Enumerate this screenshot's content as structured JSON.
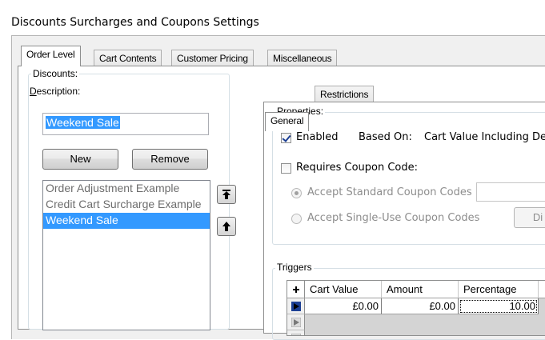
{
  "window": {
    "title": "Discounts Surcharges and Coupons Settings"
  },
  "main_tabs": [
    {
      "label": "Order Level",
      "active": true
    },
    {
      "label": "Cart Contents",
      "active": false
    },
    {
      "label": "Customer Pricing",
      "active": false
    },
    {
      "label": "Miscellaneous",
      "active": false
    }
  ],
  "discounts": {
    "group_label": "Discounts:",
    "description_label": "Description:",
    "description_value": "Weekend Sale",
    "new_button": "New",
    "remove_button": "Remove",
    "list_items": [
      {
        "label": "Order Adjustment Example",
        "selected": false
      },
      {
        "label": "Credit Cart Surcharge Example",
        "selected": false
      },
      {
        "label": "Weekend Sale",
        "selected": true
      }
    ],
    "move_top_icon": "move-to-top-icon",
    "move_up_icon": "move-up-icon"
  },
  "detail_tabs": [
    {
      "label": "General",
      "active": true
    },
    {
      "label": "Restrictions",
      "active": false
    }
  ],
  "properties": {
    "group_label": "Properties:",
    "enabled_label": "Enabled",
    "enabled_checked": true,
    "based_on_label": "Based On:",
    "based_on_value": "Cart Value Including De",
    "requires_coupon_label": "Requires Coupon Code:",
    "requires_coupon_checked": false,
    "accept_standard_label": "Accept Standard Coupon Codes",
    "accept_standard_checked": true,
    "accept_single_use_label": "Accept Single-Use Coupon Codes",
    "accept_single_use_checked": false,
    "single_use_button": "Di"
  },
  "triggers": {
    "group_label": "Triggers",
    "add_icon": "add-icon",
    "columns": [
      "Cart Value",
      "Amount",
      "Percentage"
    ],
    "rows": [
      {
        "cart_value": "£0.00",
        "amount": "£0.00",
        "percentage": "10.00"
      }
    ]
  },
  "colors": {
    "selection": "#3399ff",
    "frame_background": "#f0f0f0",
    "row_indicator": "#1c3f94"
  }
}
